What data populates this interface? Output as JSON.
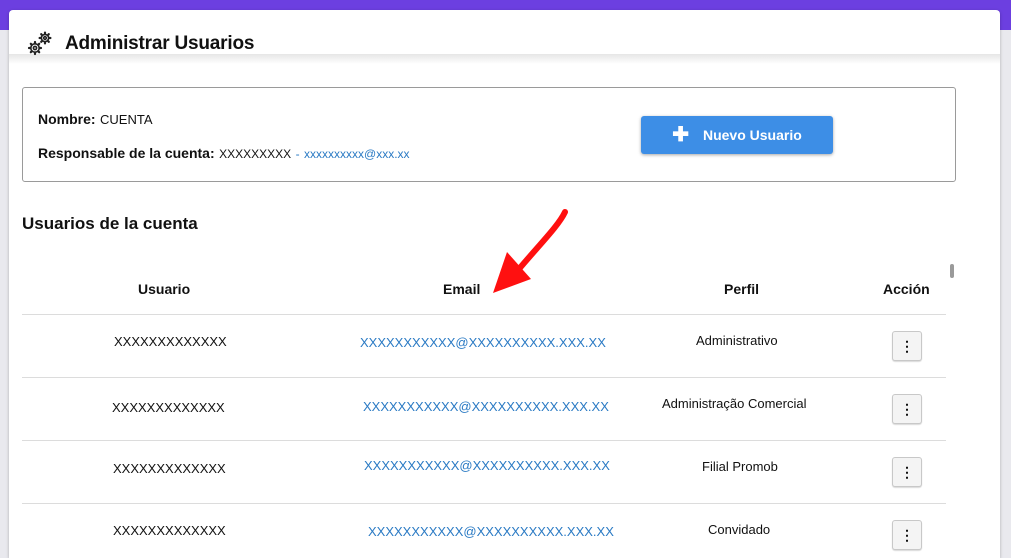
{
  "header": {
    "title": "Administrar Usuarios",
    "icon": "gears-icon"
  },
  "account": {
    "name_label": "Nombre:",
    "name_value": "CUENTA",
    "owner_label": "Responsable de la cuenta:",
    "owner_value": "XXXXXXXXX",
    "owner_sep": "-",
    "owner_email": "xxxxxxxxxx@xxx.xx"
  },
  "new_user_button": {
    "label": "Nuevo Usuario",
    "icon": "plus-icon"
  },
  "users_section": {
    "title": "Usuarios de la cuenta"
  },
  "table": {
    "headers": {
      "user": "Usuario",
      "email": "Email",
      "profile": "Perfil",
      "action": "Acción"
    },
    "rows": [
      {
        "user": "XXXXXXXXXXXXX",
        "email": "XXXXXXXXXXX@XXXXXXXXXX.XXX.XX",
        "profile": "Administrativo",
        "action_icon": "kebab-menu-icon"
      },
      {
        "user": "XXXXXXXXXXXXX",
        "email": "XXXXXXXXXXX@XXXXXXXXXX.XXX.XX",
        "profile": "Administração Comercial",
        "action_icon": "kebab-menu-icon"
      },
      {
        "user": "XXXXXXXXXXXXX",
        "email": "XXXXXXXXXXX@XXXXXXXXXX.XXX.XX",
        "profile": "Filial Promob",
        "action_icon": "kebab-menu-icon"
      },
      {
        "user": "XXXXXXXXXXXXX",
        "email": "XXXXXXXXXXX@XXXXXXXXXX.XXX.XX",
        "profile": "Convidado",
        "action_icon": "kebab-menu-icon"
      }
    ]
  },
  "annotation": {
    "type": "red-arrow",
    "color": "#ff0000"
  },
  "colors": {
    "accent": "#3d8ee6",
    "topbar": "#6c3fe0",
    "link": "#2a7ac4"
  }
}
